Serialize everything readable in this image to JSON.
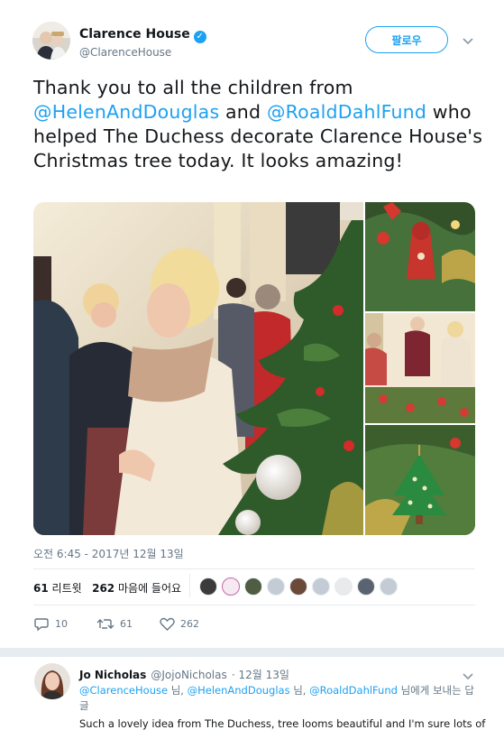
{
  "tweet": {
    "author_name": "Clarence House",
    "author_handle": "@ClarenceHouse",
    "follow_label": "팔로우",
    "text_part1": "Thank you to all the children from ",
    "mention1": "@HelenAndDouglas",
    "text_part2": " and ",
    "mention2": "@RoaldDahlFund",
    "text_part3": " who helped The Duchess decorate Clarence House's Christmas tree today. It looks amazing!",
    "timestamp": "오전 6:45 - 2017년 12월 13일",
    "retweet_count": "61",
    "retweet_label": "리트윗",
    "like_count": "262",
    "like_label": "마음에 들어요",
    "actions": {
      "replies": "10",
      "retweets": "61",
      "likes": "262"
    },
    "likers_count": 9
  },
  "reply": {
    "author_name": "Jo Nicholas",
    "author_handle": "@JojoNicholas",
    "date": "· 12월 13일",
    "replying_to_1": "@ClarenceHouse",
    "replying_to_sep1": " 님, ",
    "replying_to_2": "@HelenAndDouglas",
    "replying_to_sep2": " 님, ",
    "replying_to_3": "@RoaldDahlFund",
    "replying_to_suffix": " 님에게 보내는 답글",
    "text": "Such a lovely idea from The Duchess, tree looms beautiful and I'm sure lots of"
  },
  "colors": {
    "accent": "#1da1f2",
    "muted": "#657786",
    "border": "#e6ecf0"
  }
}
